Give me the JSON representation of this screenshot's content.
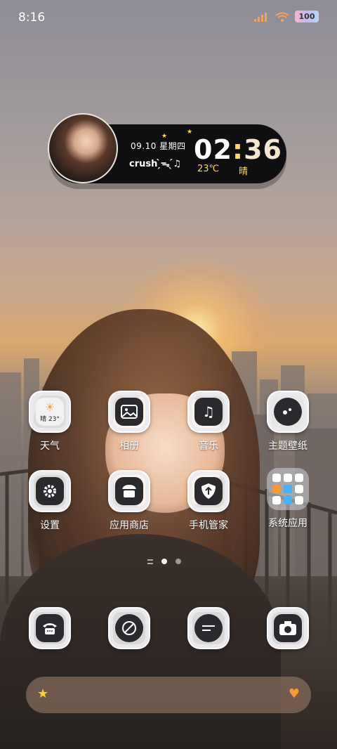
{
  "status_bar": {
    "time": "8:16",
    "battery": "100"
  },
  "widget": {
    "date": "09.10 星期四",
    "text": "crush ̗̀ᯓ ̖́♫",
    "clock_hours": "02",
    "clock_colon": ":",
    "clock_minutes": "36",
    "temperature": "23℃",
    "weather": "晴"
  },
  "apps": [
    {
      "label": "天气",
      "icon": "weather-icon",
      "glyph_text": "晴 23°"
    },
    {
      "label": "相册",
      "icon": "gallery-icon"
    },
    {
      "label": "音乐",
      "icon": "music-icon"
    },
    {
      "label": "主题壁纸",
      "icon": "themes-icon"
    },
    {
      "label": "设置",
      "icon": "settings-gear-icon"
    },
    {
      "label": "应用商店",
      "icon": "app-store-icon"
    },
    {
      "label": "手机管家",
      "icon": "security-shield-icon"
    },
    {
      "label": "系统应用",
      "icon": "folder-icon"
    }
  ],
  "dock": [
    {
      "icon": "phone-icon"
    },
    {
      "icon": "browser-icon"
    },
    {
      "icon": "messages-icon"
    },
    {
      "icon": "camera-icon"
    }
  ],
  "search_bar": {
    "left_icon": "star-icon",
    "right_icon": "heart-icon"
  },
  "colors": {
    "accent": "#ffd56a",
    "widget_bg": "#0f0f12"
  }
}
